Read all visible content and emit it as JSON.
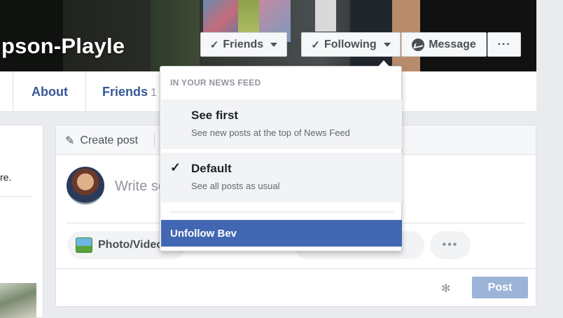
{
  "profile": {
    "name": "pson-Playle"
  },
  "cover_buttons": {
    "friends": {
      "icon": "check-icon",
      "label": "Friends"
    },
    "following": {
      "icon": "check-icon",
      "label": "Following"
    },
    "message": {
      "icon": "messenger-icon",
      "label": "Message"
    },
    "more": {
      "label": "···"
    }
  },
  "nav": {
    "about": "About",
    "friends": "Friends",
    "friends_count": "1"
  },
  "left": {
    "text": "re."
  },
  "composer": {
    "create_post": "Create post",
    "placeholder": "Write so",
    "photo_video": "Photo/Video",
    "more": "•••",
    "post": "Post"
  },
  "dropdown": {
    "heading": "IN YOUR NEWS FEED",
    "options": [
      {
        "title": "See first",
        "desc": "See new posts at the top of News Feed",
        "checked": false
      },
      {
        "title": "Default",
        "desc": "See all posts as usual",
        "checked": true
      }
    ],
    "unfollow": "Unfollow Bev"
  },
  "colors": {
    "accent": "#4267b2",
    "link": "#385898",
    "post_button_disabled": "#9cb4d8"
  }
}
